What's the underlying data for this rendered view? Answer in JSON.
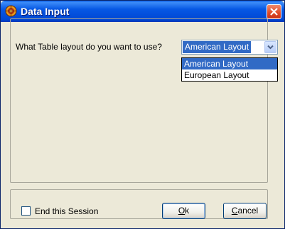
{
  "window": {
    "title": "Data Input",
    "icon": "data-input-app-icon",
    "close_icon": "close-icon"
  },
  "question": {
    "label": "What Table layout do you want to use?"
  },
  "layout_select": {
    "selected_value": "American Layout",
    "options": [
      "American Layout",
      "European Layout"
    ],
    "highlighted_option": "American Layout"
  },
  "session": {
    "checkbox_label": "End this Session",
    "checked": false
  },
  "buttons": {
    "ok_mnemonic": "O",
    "ok_rest": "k",
    "cancel_mnemonic": "C",
    "cancel_rest": "ancel"
  },
  "colors": {
    "titlebar": "#0058e6",
    "selection": "#316ac5",
    "dialog_bg": "#ece9d8",
    "close_button": "#e04a26"
  }
}
